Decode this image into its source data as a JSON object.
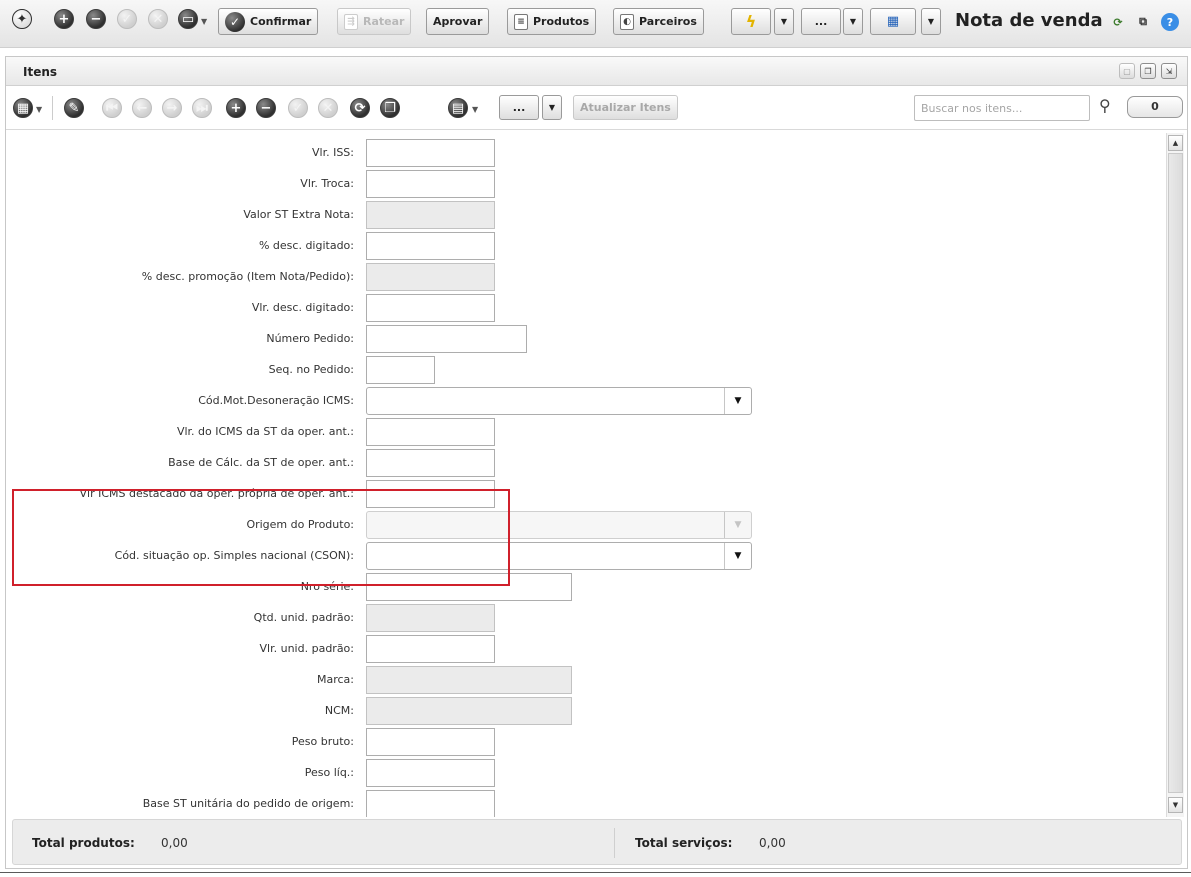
{
  "toolbar": {
    "confirm_label": "Confirmar",
    "ratear_label": "Ratear",
    "approve_label": "Aprovar",
    "products_label": "Produtos",
    "partners_label": "Parceiros",
    "more_label": "...",
    "window_title": "Nota de venda"
  },
  "panel": {
    "title": "Itens",
    "toolbar": {
      "more_label": "...",
      "update_items_label": "Atualizar Itens",
      "search_placeholder": "Buscar nos itens...",
      "count": "0"
    }
  },
  "form": {
    "fields": [
      {
        "label": "Vlr. ISS:",
        "value": "",
        "kind": "text"
      },
      {
        "label": "Vlr. Troca:",
        "value": "",
        "kind": "text"
      },
      {
        "label": "Valor ST Extra Nota:",
        "value": "",
        "kind": "readonly"
      },
      {
        "label": "% desc. digitado:",
        "value": "",
        "kind": "text"
      },
      {
        "label": "% desc. promoção (Item Nota/Pedido):",
        "value": "",
        "kind": "readonly"
      },
      {
        "label": "Vlr. desc. digitado:",
        "value": "",
        "kind": "text"
      },
      {
        "label": "Número Pedido:",
        "value": "",
        "kind": "text"
      },
      {
        "label": "Seq. no Pedido:",
        "value": "",
        "kind": "text"
      },
      {
        "label": "Cód.Mot.Desoneração ICMS:",
        "value": "",
        "kind": "select"
      },
      {
        "label": "Vlr. do ICMS da  ST da oper. ant.:",
        "value": "",
        "kind": "text"
      },
      {
        "label": "Base de Cálc. da ST de oper. ant.:",
        "value": "",
        "kind": "text"
      },
      {
        "label": "Vlr ICMS destacado da oper. própria de oper. ant.:",
        "value": "",
        "kind": "text"
      },
      {
        "label": "Origem do Produto:",
        "value": "",
        "kind": "select-disabled"
      },
      {
        "label": "Cód. situação op. Simples nacional (CSON):",
        "value": "",
        "kind": "select"
      },
      {
        "label": "Nro série:",
        "value": "",
        "kind": "text"
      },
      {
        "label": "Qtd. unid. padrão:",
        "value": "",
        "kind": "readonly"
      },
      {
        "label": "Vlr. unid. padrão:",
        "value": "",
        "kind": "text"
      },
      {
        "label": "Marca:",
        "value": "",
        "kind": "readonly"
      },
      {
        "label": "NCM:",
        "value": "",
        "kind": "readonly"
      },
      {
        "label": "Peso bruto:",
        "value": "",
        "kind": "text"
      },
      {
        "label": "Peso líq.:",
        "value": "",
        "kind": "text"
      },
      {
        "label": "Base ST unitária do pedido de origem:",
        "value": "",
        "kind": "text"
      }
    ]
  },
  "totals": {
    "products_label": "Total produtos:",
    "products_value": "0,00",
    "services_label": "Total serviços:",
    "services_value": "0,00"
  },
  "colors": {
    "highlight": "#d0202b",
    "readonly_field": "#ebebeb"
  }
}
